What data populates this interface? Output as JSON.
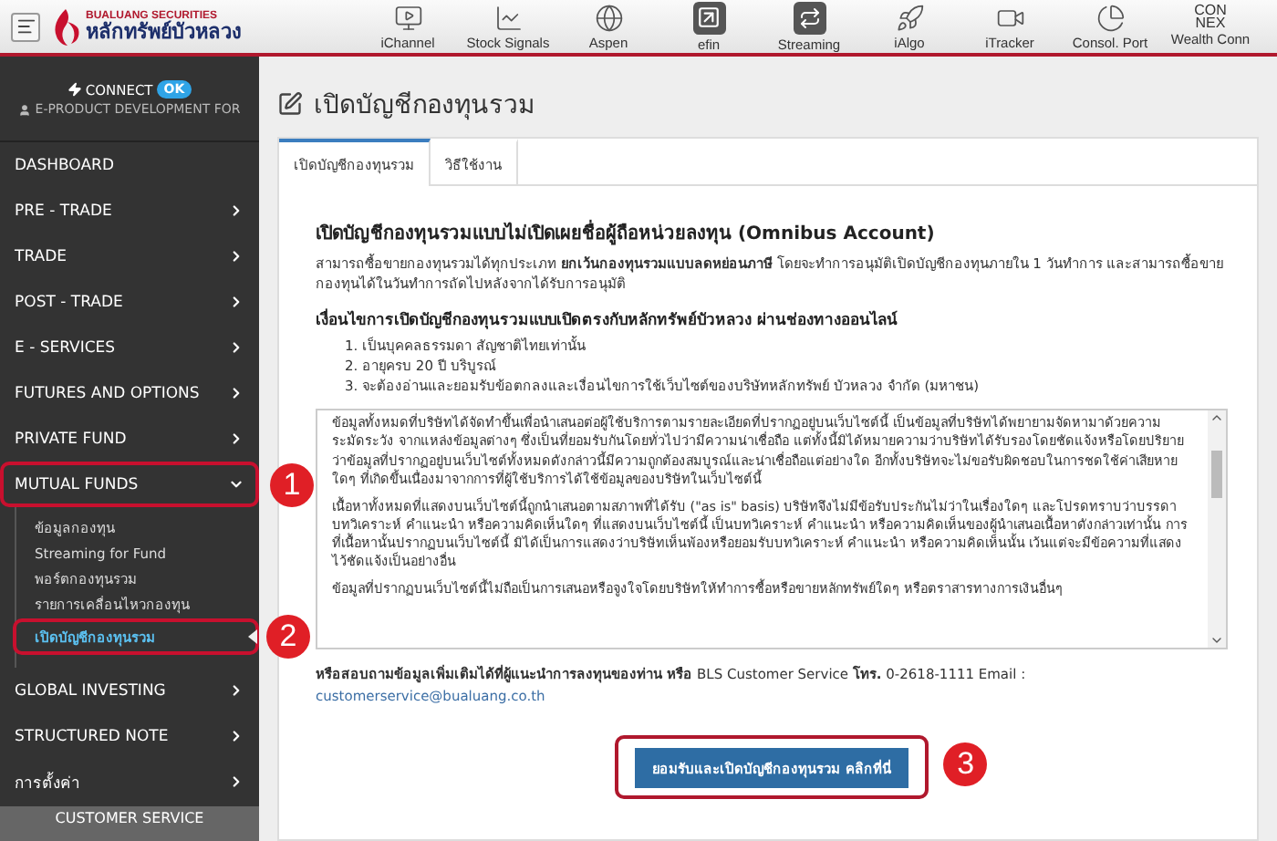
{
  "header": {
    "logo": {
      "brand": "BUALUANG SECURITIES",
      "name_thai": "หลักทรัพย์บัวหลวง"
    },
    "apps": [
      {
        "label": "iChannel",
        "kind": "monitor"
      },
      {
        "label": "Stock Signals",
        "kind": "chart"
      },
      {
        "label": "Aspen",
        "kind": "globe"
      },
      {
        "label": "efin",
        "kind": "arrow"
      },
      {
        "label": "Streaming",
        "kind": "stream"
      },
      {
        "label": "iAlgo",
        "kind": "rocket"
      },
      {
        "label": "iTracker",
        "kind": "camera"
      },
      {
        "label": "Consol. Port",
        "kind": "pie"
      },
      {
        "label": "Wealth Conn",
        "kind": "wordmark",
        "logo_lines": [
          "CON",
          "NEX"
        ]
      }
    ]
  },
  "sidebar": {
    "connect": {
      "label": "CONNECT",
      "status": "OK"
    },
    "user": "E-PRODUCT DEVELOPMENT FOR",
    "items": [
      {
        "label": "DASHBOARD",
        "kind": "link"
      },
      {
        "label": "PRE - TRADE",
        "kind": "menu",
        "expanded": false
      },
      {
        "label": "TRADE",
        "kind": "menu",
        "expanded": false
      },
      {
        "label": "POST - TRADE",
        "kind": "menu",
        "expanded": false
      },
      {
        "label": "E - SERVICES",
        "kind": "menu",
        "expanded": false
      },
      {
        "label": "FUTURES AND OPTIONS",
        "kind": "menu",
        "expanded": false
      },
      {
        "label": "PRIVATE FUND",
        "kind": "menu",
        "expanded": false
      },
      {
        "label": "MUTUAL FUNDS",
        "kind": "menu",
        "expanded": true,
        "annotation": "1",
        "children": [
          {
            "label": "ข้อมูลกองทุน",
            "selected": false
          },
          {
            "label": "Streaming for Fund",
            "selected": false
          },
          {
            "label": "พอร์ตกองทุนรวม",
            "selected": false
          },
          {
            "label": "รายการเคลื่อนไหวกองทุน",
            "selected": false
          },
          {
            "label": "เปิดบัญชีกองทุนรวม",
            "selected": true,
            "annotation": "2"
          }
        ]
      },
      {
        "label": "GLOBAL INVESTING",
        "kind": "menu",
        "expanded": false
      },
      {
        "label": "STRUCTURED NOTE",
        "kind": "menu",
        "expanded": false
      },
      {
        "label": "การตั้งค่า",
        "kind": "menu",
        "expanded": false
      }
    ],
    "footer": "CUSTOMER SERVICE"
  },
  "page": {
    "title": "เปิดบัญชีกองทุนรวม",
    "tabs": [
      {
        "label": "เปิดบัญชีกองทุนรวม",
        "selected": true
      },
      {
        "label": "วิธีใช้งาน",
        "selected": false
      }
    ],
    "heading": "เปิดบัญชีกองทุนรวมแบบไม่เปิดเผยชื่อผู้ถือหน่วยลงทุน (Omnibus Account)",
    "intro": "สามารถซื้อขายกองทุนรวมได้ทุกประเภท **ยกเว้นกองทุนรวมแบบลดหย่อนภาษี** โดยจะทำการอนุมัติเปิดบัญชีกองทุนภายใน 1 วันทำการ และสามารถซื้อขายกองทุนได้ในวันทำการถัดไปหลังจากได้รับการอนุมัติ",
    "conditions_heading": "เงื่อนไขการเปิดบัญชีกองทุนรวมแบบเปิดตรงกับหลักทรัพย์บัวหลวง ผ่านช่องทางออนไลน์",
    "conditions": [
      "1. เป็นบุคคลธรรมดา สัญชาติไทยเท่านั้น",
      "2. อายุครบ 20 ปี บริบูรณ์",
      "3. จะต้องอ่านและยอมรับข้อตกลงและเงื่อนไขการใช้เว็บไซต์ของบริษัทหลักทรัพย์ บัวหลวง จำกัด (มหาชน)"
    ],
    "terms": [
      "ข้อมูลทั้งหมดที่บริษัทได้จัดทำขึ้นเพื่อนำเสนอต่อผู้ใช้บริการตามรายละเอียดที่ปรากฏอยู่บนเว็บไซต์นี้ เป็นข้อมูลที่บริษัทได้พยายามจัดหามาด้วยความระมัดระวัง จากแหล่งข้อมูลต่างๆ ซึ่งเป็นที่ยอมรับกันโดยทั่วไปว่ามีความน่าเชื่อถือ แต่ทั้งนี้มิได้หมายความว่าบริษัทได้รับรองโดยชัดแจ้งหรือโดยปริยายว่าข้อมูลที่ปรากฏอยู่บนเว็บไซต์ทั้งหมดดังกล่าวนี้มีความถูกต้องสมบูรณ์และน่าเชื่อถือแต่อย่างใด อีกทั้งบริษัทจะไม่ขอรับผิดชอบในการชดใช้ค่าเสียหายใดๆ ที่เกิดขึ้นเนื่องมาจากการที่ผู้ใช้บริการได้ใช้ข้อมูลของบริษัทในเว็บไซต์นี้",
      "เนื้อหาทั้งหมดที่แสดงบนเว็บไซต์นี้ถูกนำเสนอตามสภาพที่ได้รับ (\"as is\" basis) บริษัทจึงไม่มีข้อรับประกันไม่ว่าในเรื่องใดๆ และโปรดทราบว่าบรรดาบทวิเคราะห์ คำแนะนำ หรือความคิดเห็นใดๆ ที่แสดงบนเว็บไซต์นี้ เป็นบทวิเคราะห์ คำแนะนำ หรือความคิดเห็นของผู้นำเสนอเนื้อหาดังกล่าวเท่านั้น การที่เนื้อหานั้นปรากฏบนเว็บไซต์นี้ มิได้เป็นการแสดงว่าบริษัทเห็นพ้องหรือยอมรับบทวิเคราะห์ คำแนะนำ หรือความคิดเห็นนั้น เว้นแต่จะมีข้อความที่แสดงไว้ชัดแจ้งเป็นอย่างอื่น",
      "ข้อมูลที่ปรากฏบนเว็บไซต์นี้ไม่ถือเป็นการเสนอหรือจูงใจโดยบริษัทให้ทำการซื้อหรือขายหลักทรัพย์ใดๆ หรือตราสารทางการเงินอื่นๆ"
    ],
    "contact": "**หรือสอบถามข้อมูลเพิ่มเติมได้ที่ผู้แนะนำการลงทุนของท่าน หรือ** BLS Customer Service **โทร.** 0-2618-1111 Email :",
    "email": "customerservice@bualuang.co.th",
    "button": {
      "label": "ยอมรับและเปิดบัญชีกองทุนรวม คลิกที่นี่",
      "annotation": "3"
    }
  }
}
